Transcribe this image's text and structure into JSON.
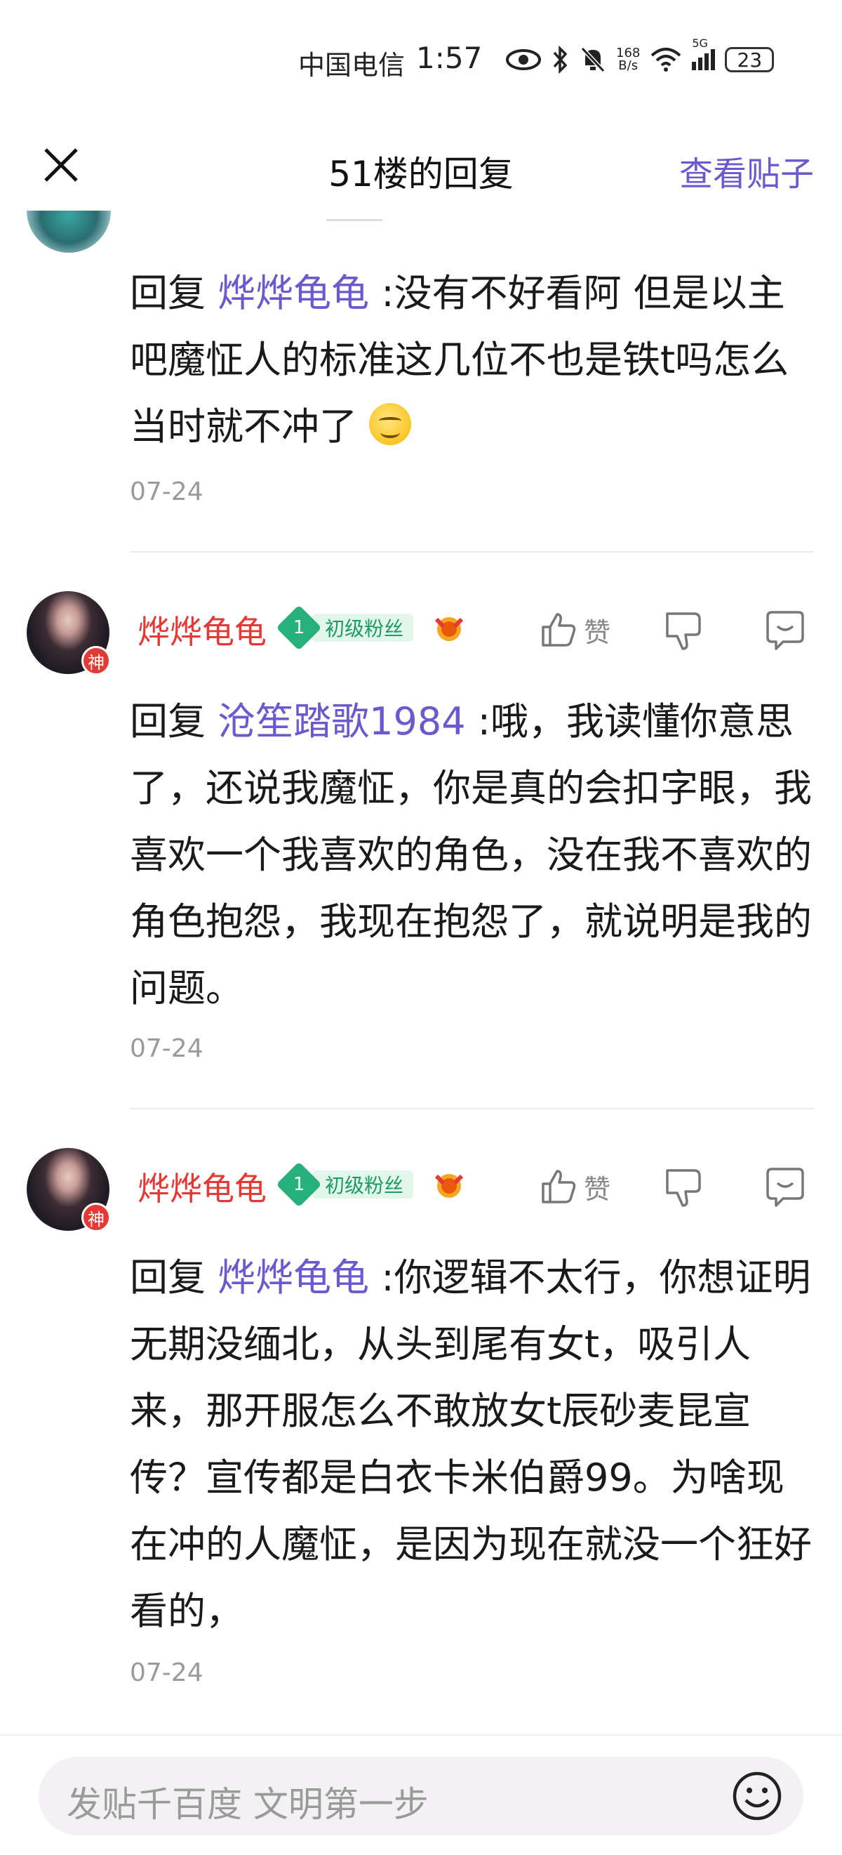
{
  "status_bar": {
    "carrier": "中国电信",
    "time": "1:57",
    "speed_top": "168",
    "speed_bottom": "B/s",
    "network": "5G",
    "battery": "23"
  },
  "header": {
    "title": "51楼的回复",
    "view_post": "查看贴子"
  },
  "top_reply": {
    "prefix": "回复 ",
    "mention": "烨烨龟龟",
    "text": " :没有不好看阿 但是以主吧魔怔人的标准这几位不也是铁t吗怎么当时就不冲了",
    "emoji_icon": "grin-emoji-icon",
    "date": "07-24"
  },
  "comments": [
    {
      "username": "烨烨龟龟",
      "avatar_badge": "神",
      "level": "1",
      "level_label": "初级粉丝",
      "like_label": "赞",
      "prefix": "回复 ",
      "mention": "沧笙踏歌1984",
      "text": " :哦，我读懂你意思了，还说我魔怔，你是真的会扣字眼，我喜欢一个我喜欢的角色，没在我不喜欢的角色抱怨，我现在抱怨了，就说明是我的问题。",
      "date": "07-24"
    },
    {
      "username": "烨烨龟龟",
      "avatar_badge": "神",
      "level": "1",
      "level_label": "初级粉丝",
      "like_label": "赞",
      "prefix": "回复 ",
      "mention": "烨烨龟龟",
      "text": " :你逻辑不太行，你想证明无期没缅北，从头到尾有女t，吸引人来，那开服怎么不敢放女t辰砂麦昆宣传？宣传都是白衣卡米伯爵99。为啥现在冲的人魔怔，是因为现在就没一个狂好看的，",
      "date": "07-24"
    }
  ],
  "bottom_bar": {
    "placeholder": "发贴千百度 文明第一步"
  },
  "colors": {
    "accent": "#6a5acd",
    "username": "#e53935",
    "level_green": "#27b07a"
  }
}
